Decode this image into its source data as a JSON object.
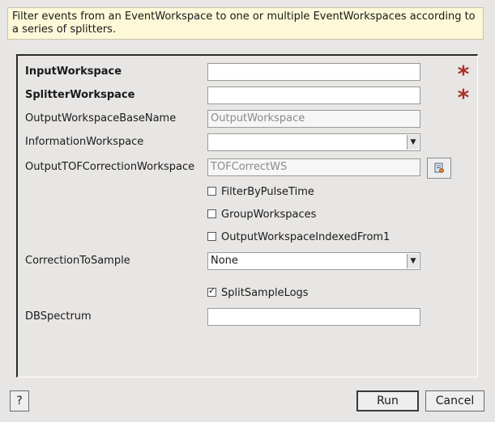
{
  "description": "Filter events from an EventWorkspace to one or multiple EventWorkspaces according to a series of splitters.",
  "fields": {
    "input_workspace": {
      "label": "InputWorkspace",
      "value": ""
    },
    "splitter_workspace": {
      "label": "SplitterWorkspace",
      "value": ""
    },
    "output_base_name": {
      "label": "OutputWorkspaceBaseName",
      "placeholder": "OutputWorkspace"
    },
    "information_workspace": {
      "label": "InformationWorkspace",
      "value": ""
    },
    "output_tof_correction": {
      "label": "OutputTOFCorrectionWorkspace",
      "placeholder": "TOFCorrectWS"
    },
    "correction_to_sample": {
      "label": "CorrectionToSample",
      "value": "None"
    },
    "db_spectrum": {
      "label": "DBSpectrum",
      "value": ""
    }
  },
  "checkboxes": {
    "filter_by_pulse_time": {
      "label": "FilterByPulseTime",
      "checked": false
    },
    "group_workspaces": {
      "label": "GroupWorkspaces",
      "checked": false
    },
    "indexed_from_1": {
      "label": "OutputWorkspaceIndexedFrom1",
      "checked": false
    },
    "split_sample_logs": {
      "label": "SplitSampleLogs",
      "checked": true,
      "mark": "✓"
    }
  },
  "required_marker": "*",
  "buttons": {
    "help": "?",
    "run": "Run",
    "cancel": "Cancel"
  },
  "colors": {
    "description_bg": "#fcf8d8",
    "required_star": "#a83226",
    "dialog_bg": "#e8e6e4"
  }
}
